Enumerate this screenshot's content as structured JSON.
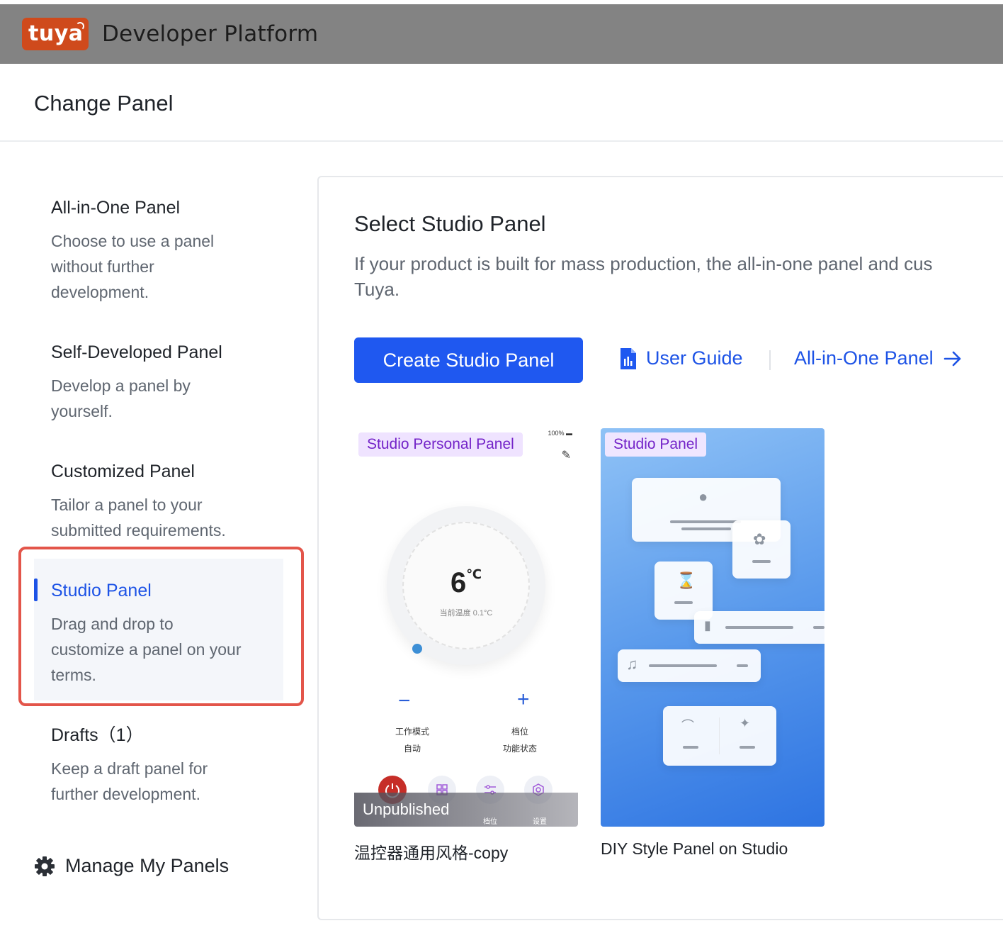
{
  "header": {
    "logo_text": "tuya",
    "platform_title": "Developer Platform"
  },
  "page": {
    "title": "Change Panel"
  },
  "sidebar": {
    "items": [
      {
        "title": "All-in-One Panel",
        "desc_lines": [
          "Choose to use a panel",
          "without further",
          "development."
        ]
      },
      {
        "title": "Self-Developed Panel",
        "desc_lines": [
          "Develop a panel by",
          "yourself."
        ]
      },
      {
        "title": "Customized Panel",
        "desc_lines": [
          "Tailor a panel to your",
          "submitted requirements."
        ]
      },
      {
        "title": "Studio Panel",
        "desc_lines": [
          "Drag and drop to",
          "customize a panel on your",
          "terms."
        ],
        "active": true
      },
      {
        "title": "Drafts（1）",
        "desc_lines": [
          "Keep a draft panel for",
          "further development."
        ]
      }
    ],
    "manage_label": "Manage My Panels",
    "manage_icon": "gear-icon"
  },
  "main": {
    "title": "Select Studio Panel",
    "description": "If your product is built for mass production, the all-in-one panel and cus",
    "description_line2": "Tuya.",
    "create_button": "Create Studio Panel",
    "user_guide": "User Guide",
    "all_in_one_link": "All-in-One Panel",
    "accent": "#1f58f0",
    "cards": [
      {
        "badge": "Studio Personal Panel",
        "status": "Unpublished",
        "name": "温控器通用风格-copy",
        "preview": {
          "battery": "100%",
          "temperature": "6",
          "unit": "℃",
          "current_temp": "当前温度 0.1°C",
          "left_ctrl": {
            "symbol": "−",
            "label": "工作模式",
            "value": "自动"
          },
          "right_ctrl": {
            "symbol": "+",
            "label": "档位",
            "value": "功能状态"
          },
          "bottom_labels": [
            "档位",
            "设置"
          ]
        }
      },
      {
        "badge": "Studio Panel",
        "name": "DIY Style Panel on Studio"
      }
    ]
  }
}
